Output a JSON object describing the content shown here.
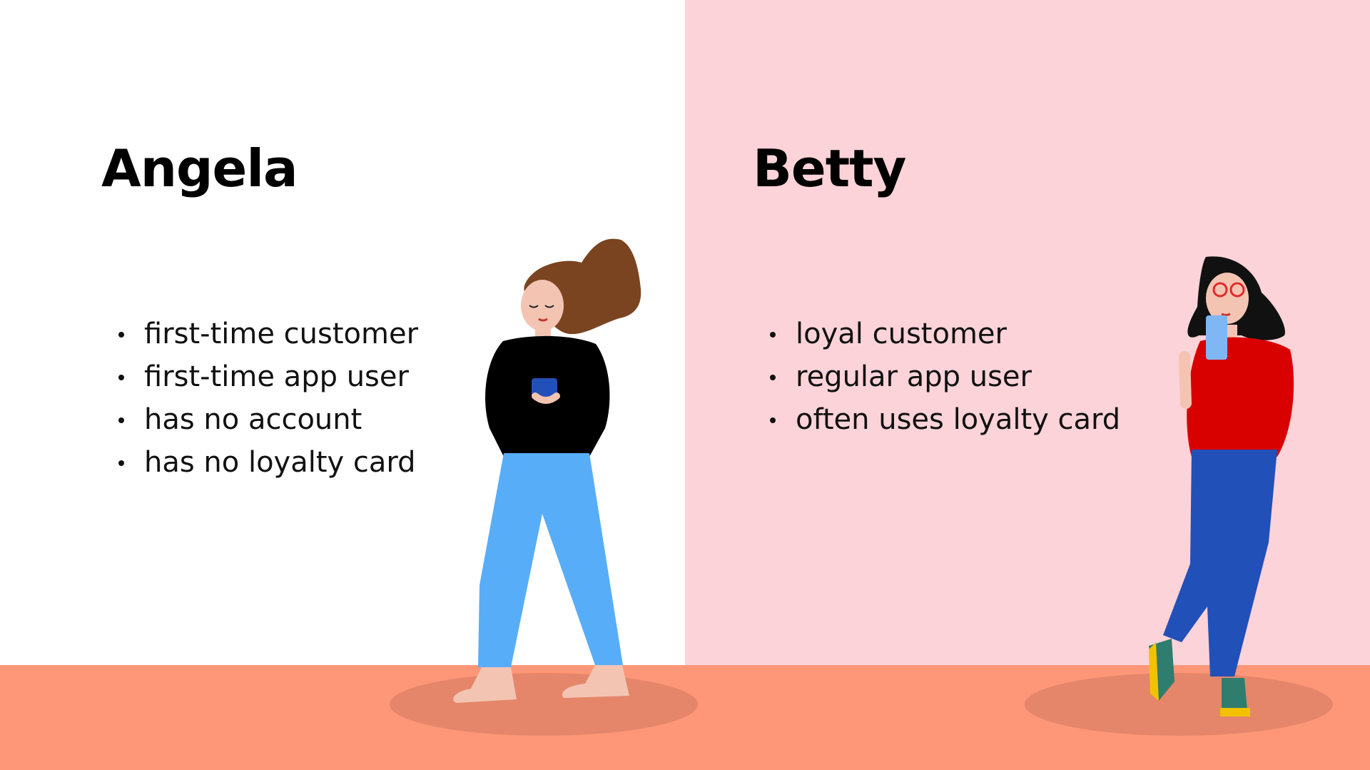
{
  "personas": [
    {
      "name": "Angela",
      "traits": [
        "first-time customer",
        "first-time app user",
        "has no account",
        "has no loyalty card"
      ]
    },
    {
      "name": "Betty",
      "traits": [
        "loyal customer",
        "regular app user",
        "often uses loyalty card"
      ]
    }
  ],
  "colors": {
    "left_background": "#ffffff",
    "right_background": "#fbd3d9",
    "floor": "#fd9778",
    "shadow": "#e5866b",
    "angela_hair": "#7a4420",
    "angela_top": "#000000",
    "angela_pants": "#58adf8",
    "betty_top": "#d90000",
    "betty_pants": "#2250b9",
    "betty_phone": "#7fb7f5",
    "betty_socks": "#2e7d6e",
    "betty_shoes": "#f2c200"
  },
  "illustrations": {
    "angela": "woman-looking-at-phone-illustration",
    "betty": "woman-with-glasses-using-phone-illustration"
  }
}
